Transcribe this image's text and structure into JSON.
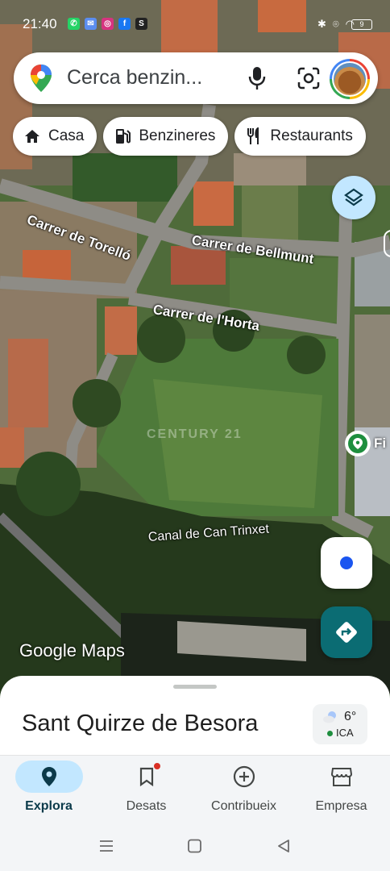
{
  "status_bar": {
    "time": "21:40",
    "battery": "9"
  },
  "search": {
    "placeholder": "Cerca benzin..."
  },
  "chips": [
    {
      "label": "Casa",
      "icon": "home-icon"
    },
    {
      "label": "Benzineres",
      "icon": "gas-station-icon"
    },
    {
      "label": "Restaurants",
      "icon": "restaurant-icon"
    }
  ],
  "map": {
    "street_labels": [
      "Carrer de Torelló",
      "Carrer de Bellmunt",
      "Carrer de l'Horta",
      "Canal de Can Trinxet"
    ],
    "watermark": "CENTURY 21",
    "attribution": "Google Maps",
    "place_pin_label": "Fi"
  },
  "sheet": {
    "title": "Sant Quirze de Besora",
    "weather_temp": "6°",
    "weather_aqi": "ICA"
  },
  "nav": {
    "items": [
      {
        "label": "Explora",
        "icon": "explore-pin-icon",
        "active": true
      },
      {
        "label": "Desats",
        "icon": "bookmark-icon",
        "active": false
      },
      {
        "label": "Contribueix",
        "icon": "add-circle-icon",
        "active": false
      },
      {
        "label": "Empresa",
        "icon": "storefront-icon",
        "active": false
      }
    ]
  },
  "colors": {
    "accent": "#c2e7ff",
    "directions": "#0b6c73",
    "location_dot": "#1a55f0",
    "place_pin": "#1e8e3e"
  }
}
